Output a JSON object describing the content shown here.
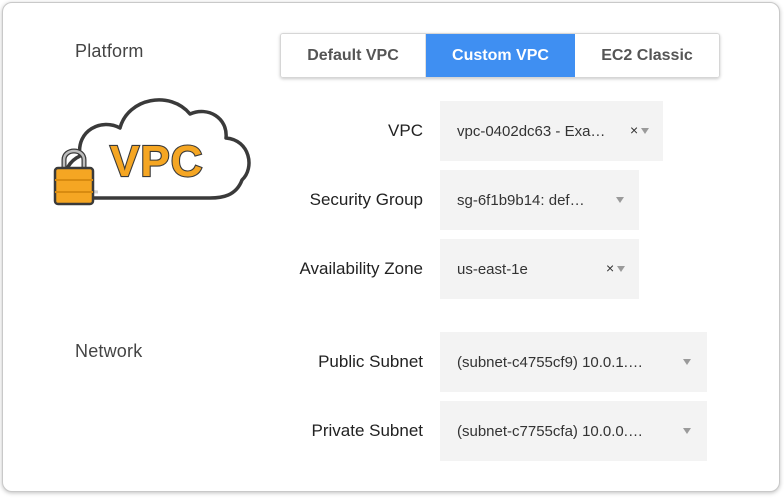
{
  "platform": {
    "label": "Platform",
    "tabs": [
      {
        "label": "Default VPC",
        "active": false
      },
      {
        "label": "Custom VPC",
        "active": true
      },
      {
        "label": "EC2 Classic",
        "active": false
      }
    ],
    "logo_text": "VPC"
  },
  "fields": {
    "vpc": {
      "label": "VPC",
      "value": "vpc-0402dc63 - Exa…",
      "clearable": true
    },
    "security_group": {
      "label": "Security Group",
      "value": "sg-6f1b9b14: def…",
      "clearable": false
    },
    "availability_zone": {
      "label": "Availability Zone",
      "value": "us-east-1e",
      "clearable": true
    }
  },
  "network": {
    "label": "Network",
    "public_subnet": {
      "label": "Public Subnet",
      "value": "(subnet-c4755cf9) 10.0.1.…"
    },
    "private_subnet": {
      "label": "Private Subnet",
      "value": "(subnet-c7755cfa) 10.0.0.…"
    }
  },
  "icons": {
    "clear": "×"
  },
  "colors": {
    "accent": "#3f8ff2",
    "cloud_outline": "#3a3a3a",
    "vpc_text": "#f5a623",
    "lock": "#f5a623"
  }
}
